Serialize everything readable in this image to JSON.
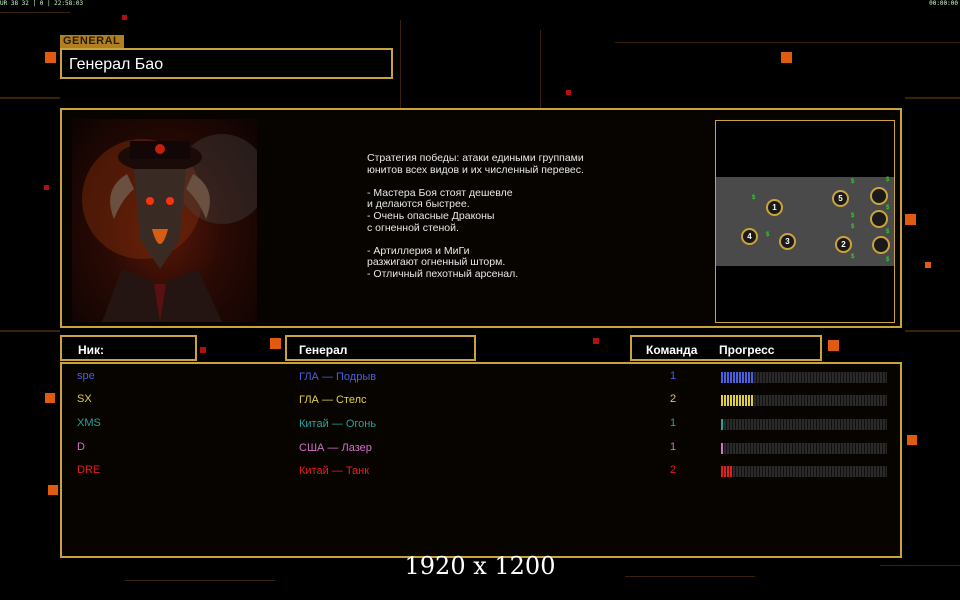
{
  "status": {
    "left_text": "UR 38 32 | 0 | 22:58:03",
    "right_text": "00:00:00"
  },
  "general": {
    "tag": "GENERAL",
    "name": "Генерал Бао"
  },
  "description": "Стратегия победы: атаки едиными группами\nюнитов всех видов и их численный перевес.\n\n- Мастера Боя стоят дешевле\nи делаются быстрее.\n- Очень опасные Драконы\nс огненной стеной.\n\n- Артиллерия и МиГи\nразжигают огненный шторм.\n- Отличный пехотный арсенал.",
  "map": {
    "cash_symbol": "$",
    "spots": [
      {
        "label": "1"
      },
      {
        "label": "2"
      },
      {
        "label": "3"
      },
      {
        "label": "4"
      },
      {
        "label": "5"
      },
      {
        "label": ""
      },
      {
        "label": ""
      },
      {
        "label": ""
      }
    ]
  },
  "table": {
    "headers": {
      "nick": "Ник:",
      "general": "Генерал",
      "team": "Команда",
      "progress": "Прогресс"
    },
    "rows": [
      {
        "nick": "spe",
        "general": "ГЛА — Подрыв",
        "team": "1",
        "progress": 0.19,
        "color": "#4a5fe0"
      },
      {
        "nick": "SX",
        "general": "ГЛА — Стелс",
        "team": "2",
        "progress": 0.19,
        "color": "#e0d040"
      },
      {
        "nick": "XMS",
        "general": "Китай — Огонь",
        "team": "1",
        "progress": 0.02,
        "color": "#2aa0a0"
      },
      {
        "nick": "D",
        "general": "США — Лазер",
        "team": "1",
        "progress": 0.02,
        "color": "#d070d0"
      },
      {
        "nick": "DRE",
        "general": "Китай — Танк",
        "team": "2",
        "progress": 0.07,
        "color": "#e02020"
      }
    ]
  },
  "caption": "1920 x 1200"
}
